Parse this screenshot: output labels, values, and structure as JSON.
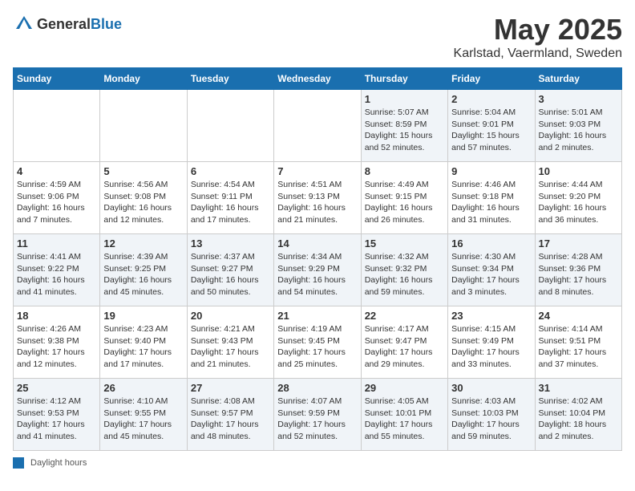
{
  "header": {
    "logo_general": "General",
    "logo_blue": "Blue",
    "month": "May 2025",
    "location": "Karlstad, Vaermland, Sweden"
  },
  "days_of_week": [
    "Sunday",
    "Monday",
    "Tuesday",
    "Wednesday",
    "Thursday",
    "Friday",
    "Saturday"
  ],
  "weeks": [
    [
      {
        "day": "",
        "info": ""
      },
      {
        "day": "",
        "info": ""
      },
      {
        "day": "",
        "info": ""
      },
      {
        "day": "",
        "info": ""
      },
      {
        "day": "1",
        "info": "Sunrise: 5:07 AM\nSunset: 8:59 PM\nDaylight: 15 hours\nand 52 minutes."
      },
      {
        "day": "2",
        "info": "Sunrise: 5:04 AM\nSunset: 9:01 PM\nDaylight: 15 hours\nand 57 minutes."
      },
      {
        "day": "3",
        "info": "Sunrise: 5:01 AM\nSunset: 9:03 PM\nDaylight: 16 hours\nand 2 minutes."
      }
    ],
    [
      {
        "day": "4",
        "info": "Sunrise: 4:59 AM\nSunset: 9:06 PM\nDaylight: 16 hours\nand 7 minutes."
      },
      {
        "day": "5",
        "info": "Sunrise: 4:56 AM\nSunset: 9:08 PM\nDaylight: 16 hours\nand 12 minutes."
      },
      {
        "day": "6",
        "info": "Sunrise: 4:54 AM\nSunset: 9:11 PM\nDaylight: 16 hours\nand 17 minutes."
      },
      {
        "day": "7",
        "info": "Sunrise: 4:51 AM\nSunset: 9:13 PM\nDaylight: 16 hours\nand 21 minutes."
      },
      {
        "day": "8",
        "info": "Sunrise: 4:49 AM\nSunset: 9:15 PM\nDaylight: 16 hours\nand 26 minutes."
      },
      {
        "day": "9",
        "info": "Sunrise: 4:46 AM\nSunset: 9:18 PM\nDaylight: 16 hours\nand 31 minutes."
      },
      {
        "day": "10",
        "info": "Sunrise: 4:44 AM\nSunset: 9:20 PM\nDaylight: 16 hours\nand 36 minutes."
      }
    ],
    [
      {
        "day": "11",
        "info": "Sunrise: 4:41 AM\nSunset: 9:22 PM\nDaylight: 16 hours\nand 41 minutes."
      },
      {
        "day": "12",
        "info": "Sunrise: 4:39 AM\nSunset: 9:25 PM\nDaylight: 16 hours\nand 45 minutes."
      },
      {
        "day": "13",
        "info": "Sunrise: 4:37 AM\nSunset: 9:27 PM\nDaylight: 16 hours\nand 50 minutes."
      },
      {
        "day": "14",
        "info": "Sunrise: 4:34 AM\nSunset: 9:29 PM\nDaylight: 16 hours\nand 54 minutes."
      },
      {
        "day": "15",
        "info": "Sunrise: 4:32 AM\nSunset: 9:32 PM\nDaylight: 16 hours\nand 59 minutes."
      },
      {
        "day": "16",
        "info": "Sunrise: 4:30 AM\nSunset: 9:34 PM\nDaylight: 17 hours\nand 3 minutes."
      },
      {
        "day": "17",
        "info": "Sunrise: 4:28 AM\nSunset: 9:36 PM\nDaylight: 17 hours\nand 8 minutes."
      }
    ],
    [
      {
        "day": "18",
        "info": "Sunrise: 4:26 AM\nSunset: 9:38 PM\nDaylight: 17 hours\nand 12 minutes."
      },
      {
        "day": "19",
        "info": "Sunrise: 4:23 AM\nSunset: 9:40 PM\nDaylight: 17 hours\nand 17 minutes."
      },
      {
        "day": "20",
        "info": "Sunrise: 4:21 AM\nSunset: 9:43 PM\nDaylight: 17 hours\nand 21 minutes."
      },
      {
        "day": "21",
        "info": "Sunrise: 4:19 AM\nSunset: 9:45 PM\nDaylight: 17 hours\nand 25 minutes."
      },
      {
        "day": "22",
        "info": "Sunrise: 4:17 AM\nSunset: 9:47 PM\nDaylight: 17 hours\nand 29 minutes."
      },
      {
        "day": "23",
        "info": "Sunrise: 4:15 AM\nSunset: 9:49 PM\nDaylight: 17 hours\nand 33 minutes."
      },
      {
        "day": "24",
        "info": "Sunrise: 4:14 AM\nSunset: 9:51 PM\nDaylight: 17 hours\nand 37 minutes."
      }
    ],
    [
      {
        "day": "25",
        "info": "Sunrise: 4:12 AM\nSunset: 9:53 PM\nDaylight: 17 hours\nand 41 minutes."
      },
      {
        "day": "26",
        "info": "Sunrise: 4:10 AM\nSunset: 9:55 PM\nDaylight: 17 hours\nand 45 minutes."
      },
      {
        "day": "27",
        "info": "Sunrise: 4:08 AM\nSunset: 9:57 PM\nDaylight: 17 hours\nand 48 minutes."
      },
      {
        "day": "28",
        "info": "Sunrise: 4:07 AM\nSunset: 9:59 PM\nDaylight: 17 hours\nand 52 minutes."
      },
      {
        "day": "29",
        "info": "Sunrise: 4:05 AM\nSunset: 10:01 PM\nDaylight: 17 hours\nand 55 minutes."
      },
      {
        "day": "30",
        "info": "Sunrise: 4:03 AM\nSunset: 10:03 PM\nDaylight: 17 hours\nand 59 minutes."
      },
      {
        "day": "31",
        "info": "Sunrise: 4:02 AM\nSunset: 10:04 PM\nDaylight: 18 hours\nand 2 minutes."
      }
    ]
  ],
  "footer": {
    "legend_label": "Daylight hours"
  }
}
